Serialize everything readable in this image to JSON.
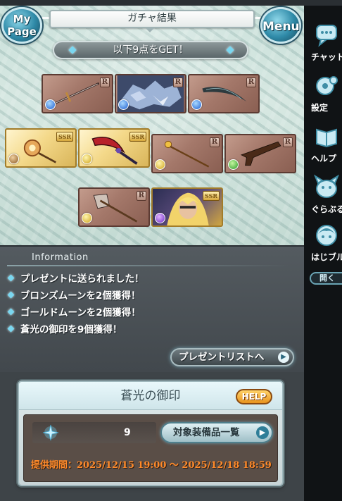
{
  "header": {
    "title": "ガチャ結果",
    "mypage_line1": "My",
    "mypage_line2": "Page",
    "menu_label": "Menu"
  },
  "result": {
    "get_text": "以下9点をGET！",
    "items": [
      {
        "rarity": "R",
        "element": "water",
        "kind": "sword"
      },
      {
        "rarity": "R",
        "element": "water",
        "kind": "dragon"
      },
      {
        "rarity": "R",
        "element": "water",
        "kind": "scythe"
      },
      {
        "rarity": "SSR",
        "element": "earth",
        "kind": "staff-orb"
      },
      {
        "rarity": "SSR",
        "element": "light",
        "kind": "axe-blade"
      },
      {
        "rarity": "R",
        "element": "light",
        "kind": "staff"
      },
      {
        "rarity": "R",
        "element": "wind",
        "kind": "gun"
      },
      {
        "rarity": "R",
        "element": "light",
        "kind": "axe"
      },
      {
        "rarity": "SSR",
        "element": "dark",
        "kind": "character"
      }
    ]
  },
  "information": {
    "title": "Information",
    "messages": [
      "プレゼントに送られました！",
      "ブロンズムーンを2個獲得！",
      "ゴールドムーンを2個獲得！",
      "蒼光の御印を9個獲得！"
    ],
    "present_button": "プレゼントリストへ"
  },
  "seal": {
    "title": "蒼光の御印",
    "help_label": "HELP",
    "count": "9",
    "equip_button": "対象装備品一覧",
    "period": "提供期間：2025/12/15 19:00 〜 2025/12/18 18:59"
  },
  "sidebar": {
    "items": [
      {
        "label": "チャット",
        "icon": "chat-icon"
      },
      {
        "label": "設定",
        "icon": "settings-icon"
      },
      {
        "label": "ヘルプ",
        "icon": "help-book-icon"
      },
      {
        "label": "ぐらぶるっ",
        "icon": "mascot-icon"
      },
      {
        "label": "はじブル",
        "icon": "guide-character-icon"
      }
    ],
    "open_label": "開く"
  },
  "colors": {
    "accent_cyan": "#7ad7f0",
    "period_orange": "#ff8a2a",
    "help_gold": "#e8931e"
  }
}
